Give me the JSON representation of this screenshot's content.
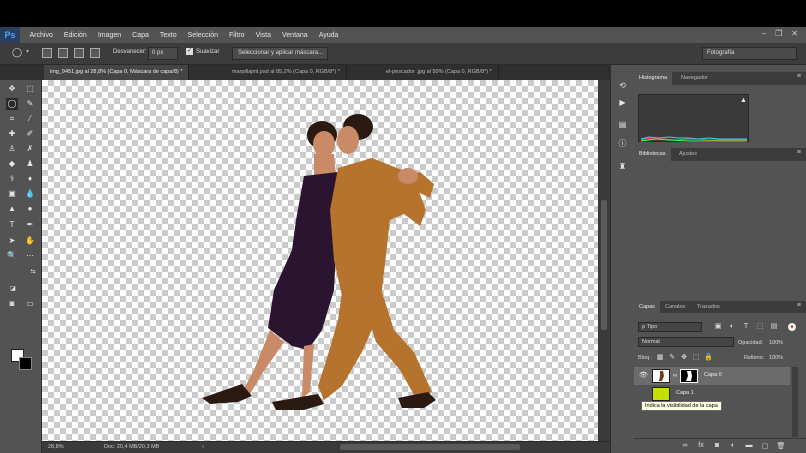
{
  "app": {
    "logo": "Ps"
  },
  "menu": [
    "Archivo",
    "Edición",
    "Imagen",
    "Capa",
    "Texto",
    "Selección",
    "Filtro",
    "Vista",
    "Ventana",
    "Ayuda"
  ],
  "window_controls": {
    "minimize": "–",
    "restore": "❐",
    "close": "✕"
  },
  "options": {
    "feather_label": "Desvanecer:",
    "feather_value": "0 px",
    "smooth_label": "Suavizar",
    "select_mask_button": "Seleccionar y aplicar máscara...",
    "workspace": "Fotografía"
  },
  "tabs": [
    "img_9451.jpg al 28,8% (Capa 0, Máscara de capa/8) *",
    "marpillajml.psd al 85,2% (Capa 0, RGB/8*) *",
    "el-pescador .jpg al 50% (Capa 0, RGB/8*) *"
  ],
  "status": {
    "zoom": "28,8%",
    "doc": "Doc: 20,4 MB/20,3 MB",
    "arrow": "›"
  },
  "panels": {
    "top_tabs": [
      "Histograma",
      "Navegador"
    ],
    "histo_warning": "▲",
    "mid_tabs": [
      "Bibliotecas",
      "Ajustes"
    ],
    "layers_tabs": [
      "Capas",
      "Canales",
      "Trazados"
    ],
    "menu_icon": "≡"
  },
  "layers": {
    "filter_kind": "ρ Tipo",
    "blend_mode": "Normal",
    "opacity_label": "Opacidad:",
    "opacity_value": "100%",
    "lock_label": "Bloq.:",
    "fill_label": "Relleno:",
    "fill_value": "100%",
    "items": [
      {
        "name": "Capa 0",
        "visible_icon": "👁"
      },
      {
        "name": "Capa 1",
        "visible_icon": ""
      }
    ],
    "tooltip": "Indica la visibilidad de la capa"
  },
  "colors": {
    "layer1_thumb": "#c4e000",
    "dress": "#2b1430",
    "suit": "#b5732e",
    "skin": "#c98a68",
    "hair": "#2a1a12"
  }
}
